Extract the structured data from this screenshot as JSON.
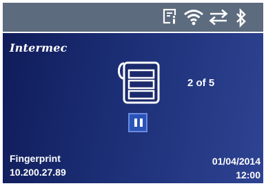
{
  "status_bar": {
    "background": "#5d6b7e",
    "icons": [
      "document-info-icon",
      "wifi-icon",
      "transfer-arrows-icon",
      "bluetooth-icon"
    ]
  },
  "display": {
    "background_from": "#101c5a",
    "background_to": "#2e4392"
  },
  "brand": {
    "logo_text": "Intermec"
  },
  "job": {
    "icon": "printer-label-icon",
    "counter": "2 of 5",
    "pause_icon": "pause-icon",
    "pause_color": "#2a53b8"
  },
  "footer": {
    "app_name": "Fingerprint",
    "ip_address": "10.200.27.89",
    "date": "01/04/2014",
    "time": "12:00"
  }
}
